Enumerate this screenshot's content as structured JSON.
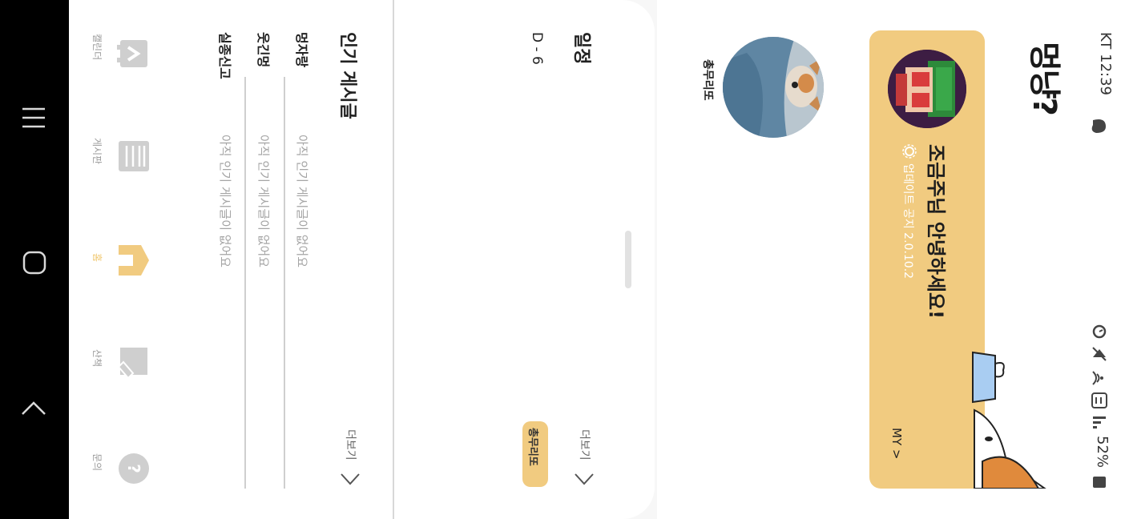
{
  "status_bar": {
    "carrier_time": "KT 12:39",
    "battery": "52%"
  },
  "app": {
    "logo_text": "멍냥?"
  },
  "banner": {
    "greeting": "조금주님 안녕하세요!",
    "update_notice": "업데이트 공지 2.0.10.2",
    "my_link": "MY >"
  },
  "profile": {
    "name": "총무리또"
  },
  "schedule": {
    "title": "일정",
    "dday": "D - 6",
    "more": "더보기",
    "chip": "총무리또"
  },
  "popular": {
    "title": "인기 게시글",
    "more": "더보기",
    "rows": [
      {
        "board": "멍자랑",
        "text": "아직 인기 게시글이 없어요"
      },
      {
        "board": "웃긴멍",
        "text": "아직 인기 게시글이 없어요"
      },
      {
        "board": "실종신고",
        "text": "아직 인기 게시글이 없어요"
      }
    ]
  },
  "tabbar": {
    "tabs": [
      {
        "label": "캘린더",
        "icon": "calendar-icon"
      },
      {
        "label": "게시판",
        "icon": "board-icon"
      },
      {
        "label": "홈",
        "icon": "home-icon"
      },
      {
        "label": "산책",
        "icon": "walk-icon"
      },
      {
        "label": "문의",
        "icon": "question-icon"
      }
    ]
  },
  "colors": {
    "accent": "#f1cb80",
    "active_tab": "#f0c870",
    "inactive": "#9a9a9a",
    "sys_nav": "#000000"
  }
}
